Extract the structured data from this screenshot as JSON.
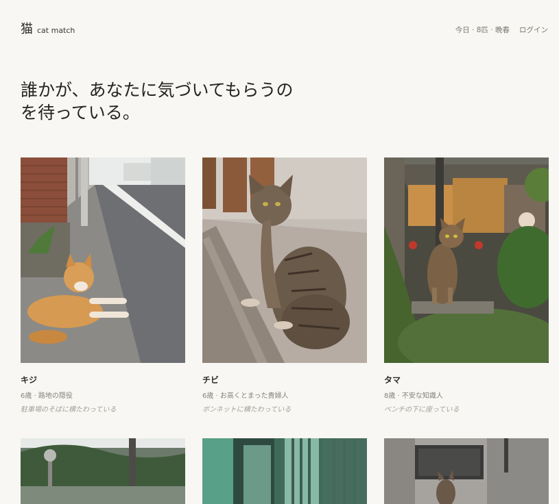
{
  "header": {
    "logo_kanji": "猫",
    "logo_text": "cat match",
    "today_info": "今日 · 8匹 · 晩春",
    "login_label": "ログイン"
  },
  "hero": {
    "headline_line1": "誰かが、あなたに気づいてもらうの",
    "headline_line2": "を待っている。"
  },
  "cats": [
    {
      "name": "キジ",
      "meta": "6歳 · 路地の隠役",
      "status": "駐車場のそばに横たわっている"
    },
    {
      "name": "チビ",
      "meta": "6歳 · お高くとまった貴婦人",
      "status": "ボンネットに横たわっている"
    },
    {
      "name": "タマ",
      "meta": "8歳 · 不安な知識人",
      "status": "ベンチの下に座っている"
    }
  ],
  "colors": {
    "background": "#f8f7f3",
    "text": "#2b2926",
    "muted": "#86827c"
  }
}
